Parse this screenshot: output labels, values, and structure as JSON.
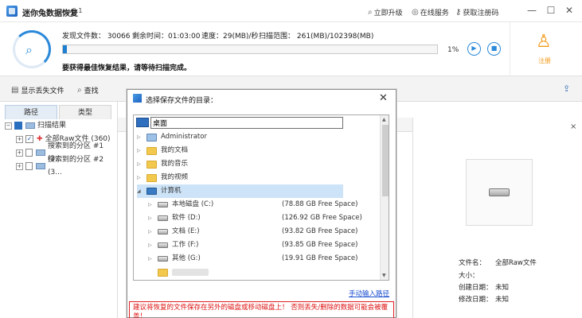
{
  "titlebar": {
    "title": "迷你兔数据恢复",
    "version": "v9.1",
    "upgrade": "立即升级",
    "online_service": "在线服务",
    "get_code": "获取注册码",
    "minimize": "—",
    "maximize": "☐",
    "close": "✕"
  },
  "header": {
    "found_files": "发现文件数：  30066",
    "remaining_time": "剩余时间：01:03:00",
    "speed": "速度：29(MB)/秒",
    "scan_range": "扫描范围：  261(MB)/102398(MB)",
    "progress_percent": 1,
    "progress_text": "1%",
    "play": "▶",
    "stop": "■",
    "hint": "要获得最佳恢复结果，请等待扫描完成。",
    "register": "注册"
  },
  "toolbar": {
    "show_lost": "显示丢失文件",
    "find": "查找"
  },
  "left": {
    "tab_path": "路径",
    "tab_type": "类型",
    "root": "扫描结果",
    "items": [
      {
        "label": "全部Raw文件 (360)"
      },
      {
        "label": "搜索到的分区 #1 (3..."
      },
      {
        "label": "搜索到的分区 #2 (3..."
      }
    ]
  },
  "preview": {
    "close": "×",
    "file_name_label": "文件名：",
    "file_name_value": "全部Raw文件",
    "size_label": "大小：",
    "created_label": "创建日期：",
    "created_value": "未知",
    "modified_label": "修改日期：",
    "modified_value": "未知"
  },
  "dialog": {
    "title": "选择保存文件的目录：",
    "close": "✕",
    "path_value": "桌面",
    "folders": [
      {
        "label": "Administrator"
      },
      {
        "label": "我的文档"
      },
      {
        "label": "我的音乐"
      },
      {
        "label": "我的视频"
      },
      {
        "label": "计算机"
      }
    ],
    "drives": [
      {
        "label": "本地磁盘 (C:)",
        "free": "(78.88 GB Free Space)"
      },
      {
        "label": "软件 (D:)",
        "free": "(126.92 GB Free Space)"
      },
      {
        "label": "文档 (E:)",
        "free": "(93.82 GB Free Space)"
      },
      {
        "label": "工作 (F:)",
        "free": "(93.85 GB Free Space)"
      },
      {
        "label": "其他 (G:)",
        "free": "(19.91 GB Free Space)"
      }
    ],
    "manual_input": "手动输入路径",
    "warning": "建议将恢复的文件保存在另外的磁盘或移动磁盘上！ 否则丢失/删除的数据可能会被覆盖！"
  }
}
